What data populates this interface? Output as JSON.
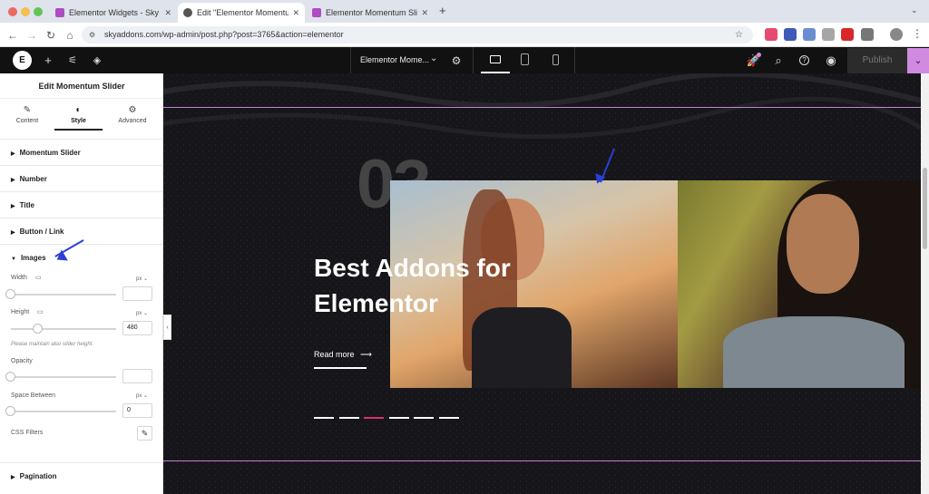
{
  "browser": {
    "tabs": [
      {
        "title": "Elementor Widgets - Sky Addo",
        "icon_color": "#b04cc3"
      },
      {
        "title": "Edit \"Elementor Momentum S",
        "icon_color": "#555555"
      },
      {
        "title": "Elementor Momentum Slider",
        "icon_color": "#b04cc3"
      }
    ],
    "new_tab": "+",
    "url": "skyaddons.com/wp-admin/post.php?post=3765&action=elementor"
  },
  "editor": {
    "document_title": "Elementor Mome...",
    "publish_label": "Publish"
  },
  "panel": {
    "title": "Edit Momentum Slider",
    "tabs": [
      {
        "label": "Content",
        "icon": "pencil-icon"
      },
      {
        "label": "Style",
        "icon": "contrast-icon"
      },
      {
        "label": "Advanced",
        "icon": "gear-icon"
      }
    ],
    "sections": [
      "Momentum Slider",
      "Number",
      "Title",
      "Button / Link"
    ],
    "images_section": "Images",
    "controls": {
      "width_label": "Width",
      "width_unit": "px",
      "width_value": "",
      "width_slider": 0,
      "height_label": "Height",
      "height_unit": "px",
      "height_value": "480",
      "height_slider": 0.26,
      "height_note": "Please maintain also slider height.",
      "opacity_label": "Opacity",
      "opacity_value": "",
      "opacity_slider": 0,
      "space_label": "Space Between",
      "space_unit": "px",
      "space_value": "0",
      "space_slider": 0,
      "filters_label": "CSS Filters"
    },
    "pagination_section": "Pagination"
  },
  "slide": {
    "number": "03",
    "heading_line1": "Best Addons for",
    "heading_line2": "Elementor",
    "read_more": "Read more",
    "read_more_arrow": "⟶",
    "dots": 6,
    "active_dot": 2
  },
  "colors": {
    "accent_pink": "#c57fd2",
    "annotation_arrow": "#2b3fd6",
    "active_dot": "#d6336c"
  }
}
